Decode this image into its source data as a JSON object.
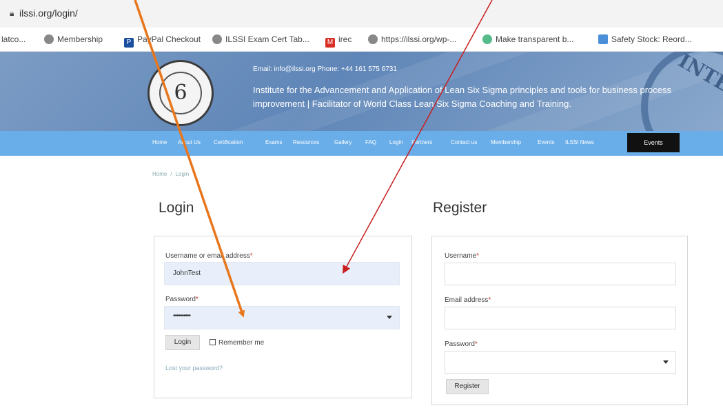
{
  "browser": {
    "url": "ilssi.org/login/",
    "bookmarks": [
      {
        "label": "latco...",
        "icon": "none"
      },
      {
        "label": "Membership",
        "icon": "globe-icon"
      },
      {
        "label": "PayPal Checkout",
        "icon": "paypal-icon"
      },
      {
        "label": "ILSSI Exam Cert Tab...",
        "icon": "globe-icon"
      },
      {
        "label": "irec",
        "icon": "gmail-icon"
      },
      {
        "label": "https://ilssi.org/wp-...",
        "icon": "globe-icon"
      },
      {
        "label": "Make transparent b...",
        "icon": "globe-icon"
      },
      {
        "label": "Safety Stock: Reord...",
        "icon": "folder-icon"
      }
    ]
  },
  "header": {
    "contact": "Email: info@ilssi.org  Phone: +44 161 575 6731",
    "tagline": "Institute for the Advancement and Application of Lean Six Sigma principles and tools for business process improvement | Facilitator of World Class Lean Six Sigma Coaching and Training.",
    "seal_text": "INTER"
  },
  "nav": {
    "items": [
      "Home",
      "About Us",
      "Certification",
      "Exams",
      "Resources",
      "Gallery",
      "FAQ",
      "Login",
      "Partners",
      "Contact us",
      "Membership",
      "Events",
      "ILSSI News"
    ],
    "events_button": "Events"
  },
  "breadcrumb": {
    "home": "Home",
    "current": "Login"
  },
  "login": {
    "title": "Login",
    "username_label": "Username or email address",
    "username_value": "JohnTest",
    "password_label": "Password",
    "password_value": "••••••••••",
    "submit": "Login",
    "remember": "Remember me",
    "lost_password": "Lost your password?"
  },
  "register": {
    "title": "Register",
    "username_label": "Username",
    "email_label": "Email address",
    "password_label": "Password",
    "submit": "Register"
  },
  "required_mark": "*",
  "colors": {
    "nav_bg": "#6aaee9",
    "header_bg": "#6f90bd",
    "arrow_orange": "#e8761c",
    "arrow_red": "#c81e1e",
    "field_filled": "#e8effa"
  }
}
